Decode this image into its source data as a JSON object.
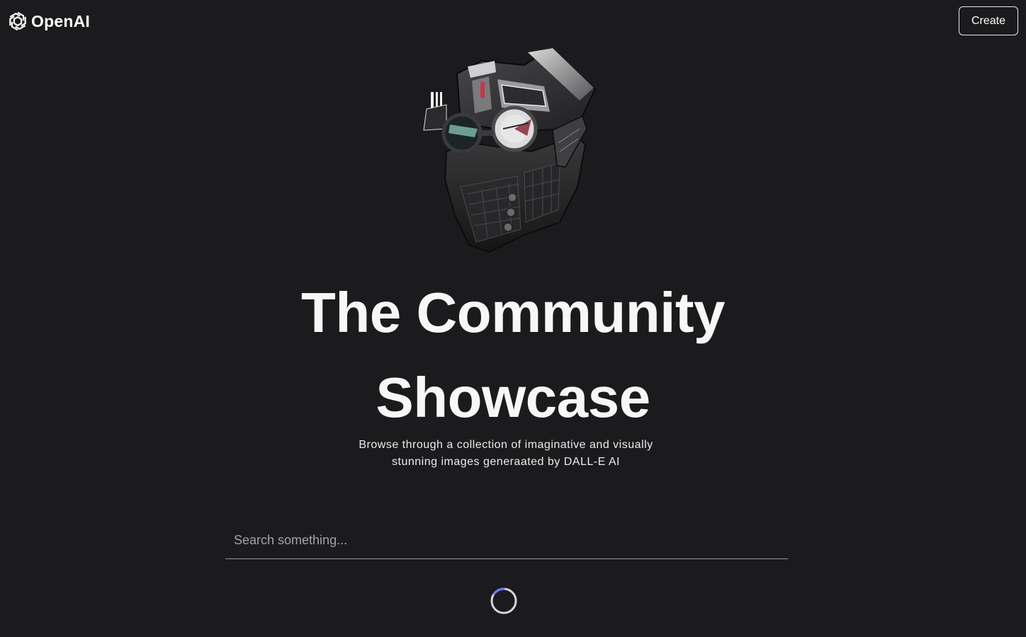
{
  "header": {
    "brand_name": "OpenAI",
    "create_label": "Create"
  },
  "hero": {
    "title_line1": "The Community",
    "title_line2": "Showcase",
    "subtitle_line1": "Browse through a collection of imaginative and visually",
    "subtitle_line2": "stunning images generaated by DALL-E AI"
  },
  "search": {
    "placeholder": "Search something...",
    "value": ""
  },
  "icons": {
    "brand": "openai-logo-icon",
    "hero": "robot-head-illustration",
    "loading": "loading-spinner-icon"
  },
  "colors": {
    "background": "#1b1b1d",
    "text": "#ffffff",
    "spinner_accent": "#6d79f5"
  }
}
